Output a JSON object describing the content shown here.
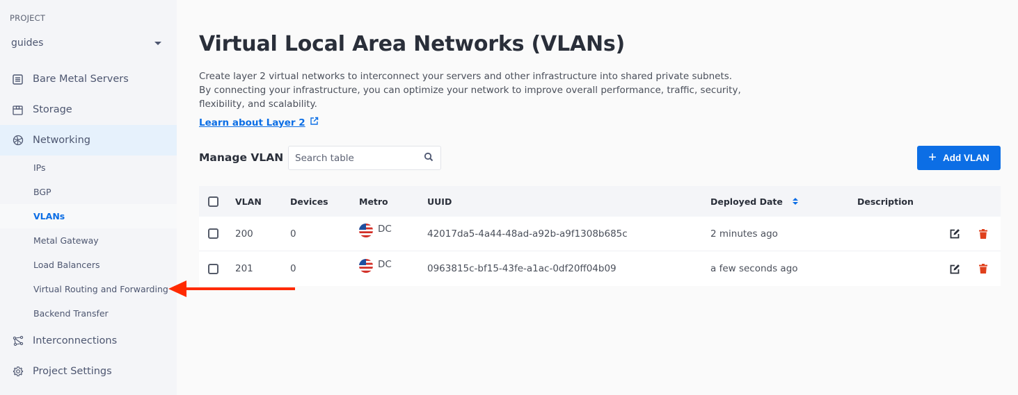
{
  "sidebar": {
    "project_label": "PROJECT",
    "project_name": "guides",
    "items": [
      {
        "label": "Bare Metal Servers",
        "icon": "server-icon"
      },
      {
        "label": "Storage",
        "icon": "storage-box-icon"
      },
      {
        "label": "Networking",
        "icon": "network-globe-icon"
      },
      {
        "label": "Interconnections",
        "icon": "interconnection-icon"
      },
      {
        "label": "Project Settings",
        "icon": "gear-icon"
      }
    ],
    "networking_sub": [
      {
        "label": "IPs"
      },
      {
        "label": "BGP"
      },
      {
        "label": "VLANs"
      },
      {
        "label": "Metal Gateway"
      },
      {
        "label": "Load Balancers"
      },
      {
        "label": "Virtual Routing and Forwarding"
      },
      {
        "label": "Backend Transfer"
      }
    ],
    "active_item": "Networking",
    "active_sub": "VLANs"
  },
  "main": {
    "title": "Virtual Local Area Networks (VLANs)",
    "description": "Create layer 2 virtual networks to interconnect your servers and other infrastructure into shared private subnets. By connecting your infrastructure, you can optimize your network to improve overall performance, traffic, security, flexibility, and scalability.",
    "learn_link": "Learn about Layer 2",
    "manage_label": "Manage VLAN",
    "search_placeholder": "Search table",
    "add_button": "Add VLAN"
  },
  "table": {
    "columns": [
      "VLAN",
      "Devices",
      "Metro",
      "UUID",
      "Deployed Date",
      "Description"
    ],
    "rows": [
      {
        "vlan": "200",
        "devices": "0",
        "metro": "DC",
        "uuid": "42017da5-4a44-48ad-a92b-a9f1308b685c",
        "deployed": "2 minutes ago",
        "description": ""
      },
      {
        "vlan": "201",
        "devices": "0",
        "metro": "DC",
        "uuid": "0963815c-bf15-43fe-a1ac-0df20ff04b09",
        "deployed": "a few seconds ago",
        "description": ""
      }
    ]
  },
  "annotation": {
    "type": "arrow",
    "color": "#ff2a00",
    "points_to": "Virtual Routing and Forwarding"
  },
  "colors": {
    "accent": "#0c6ee5",
    "delete": "#e0401c",
    "sidebar_bg": "#f4f5f8",
    "active_bg": "#e6f1fc"
  }
}
